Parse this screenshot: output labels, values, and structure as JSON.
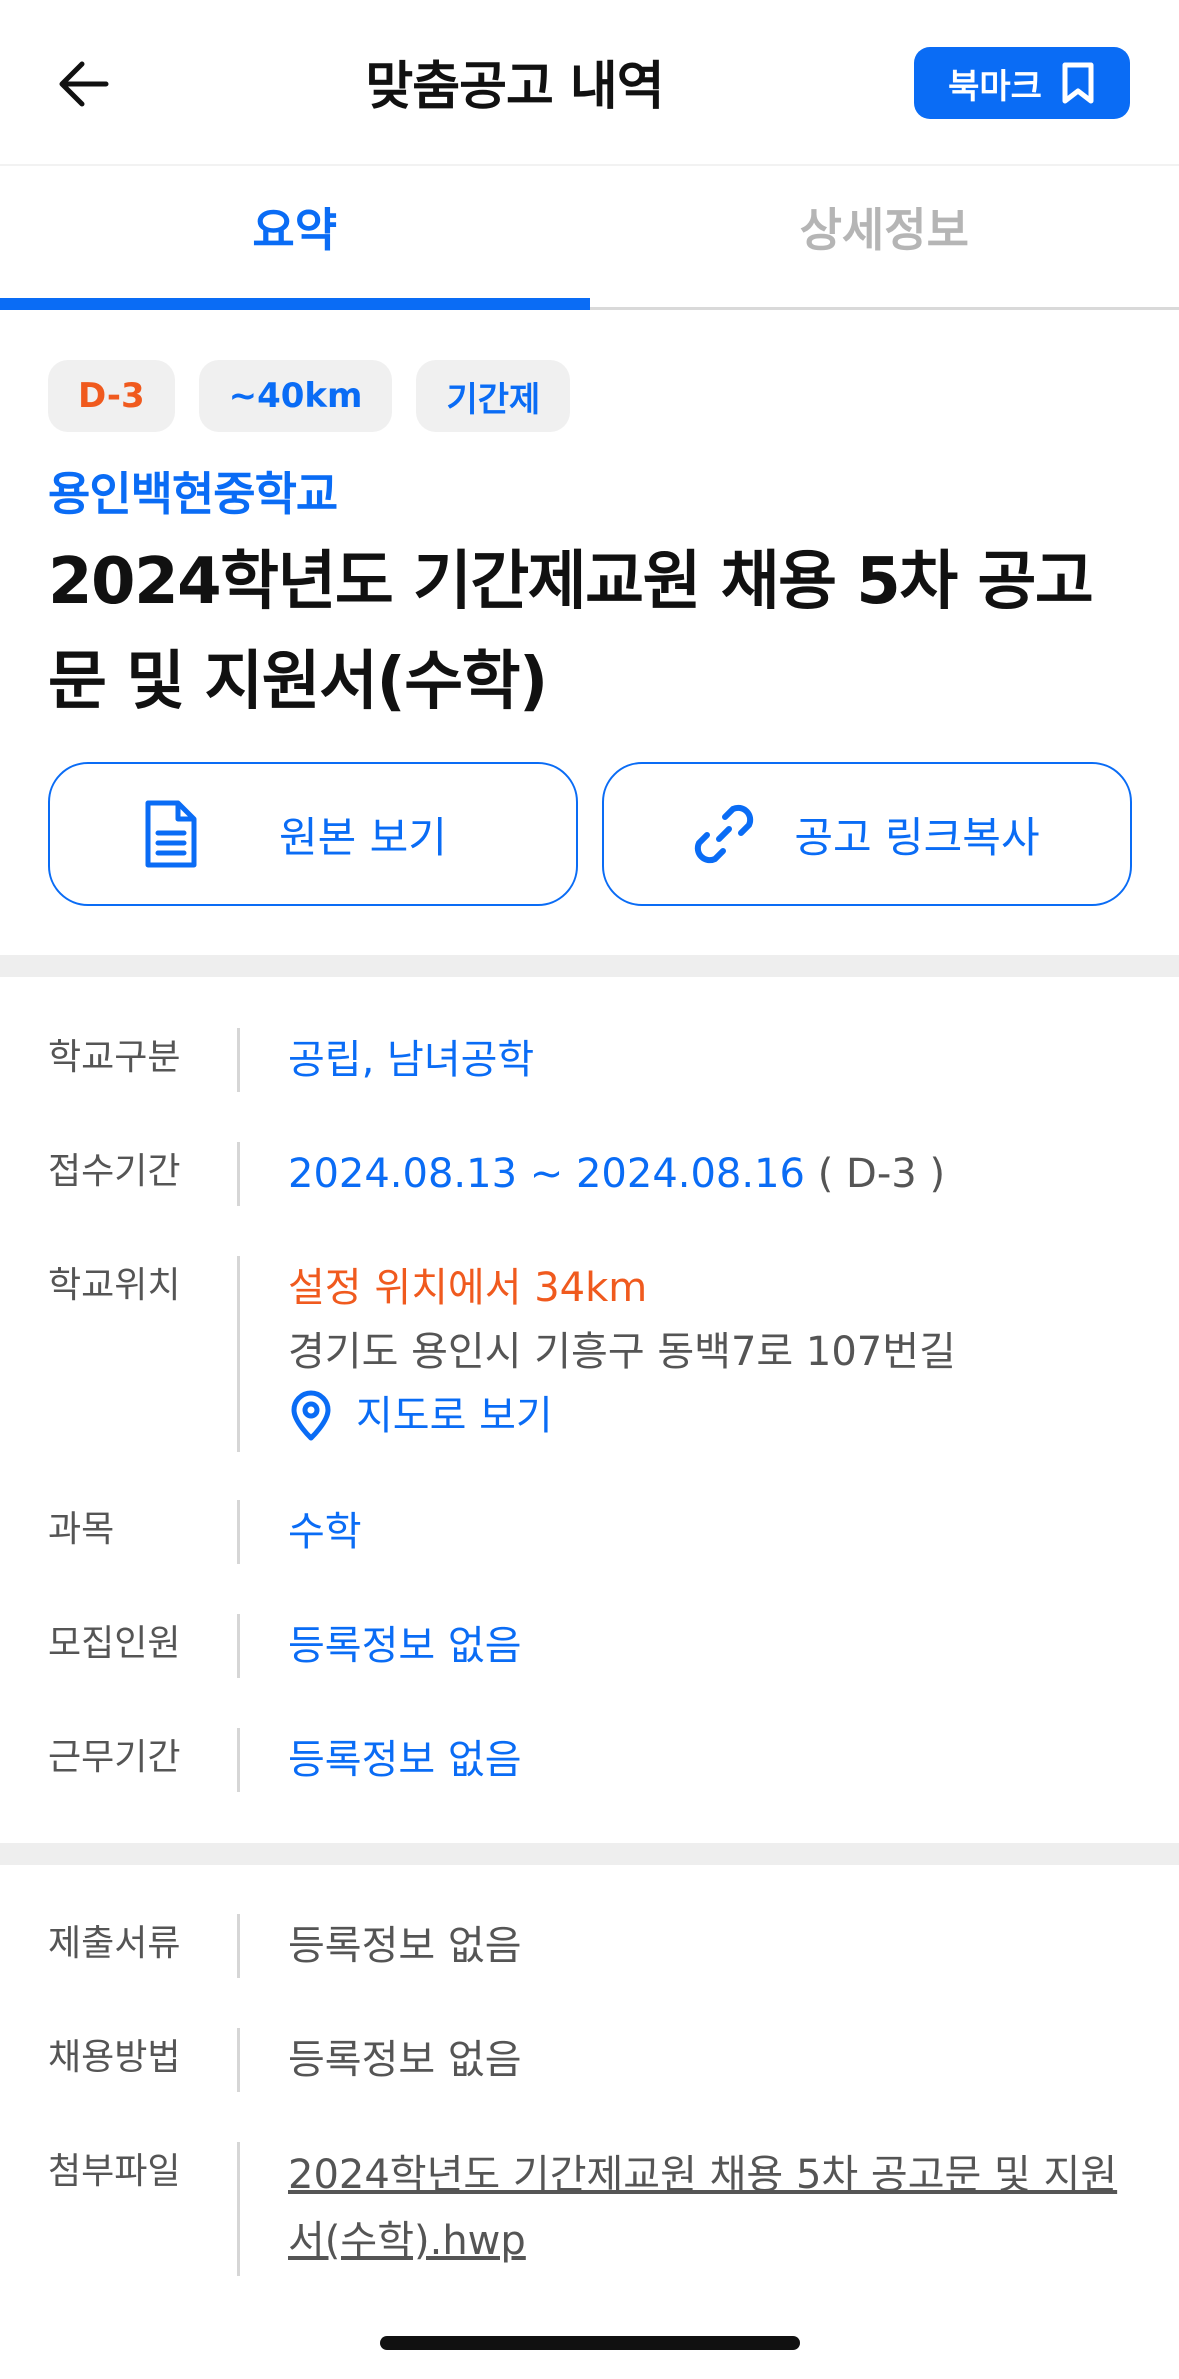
{
  "header": {
    "title": "맞춤공고 내역",
    "bookmark_label": "북마크"
  },
  "tabs": [
    {
      "label": "요약",
      "active": true
    },
    {
      "label": "상세정보",
      "active": false
    }
  ],
  "badges": {
    "deadline": "D-3",
    "distance": "~40km",
    "type": "기간제"
  },
  "school_name": "용인백현중학교",
  "job_title": "2024학년도 기간제교원 채용 5차 공고문 및 지원서(수학)",
  "actions": {
    "original": "원본 보기",
    "copy_link": "공고 링크복사"
  },
  "info": {
    "school_type": {
      "label": "학교구분",
      "value": "공립, 남녀공학"
    },
    "period": {
      "label": "접수기간",
      "value": "2024.08.13 ~ 2024.08.16",
      "suffix": "( D-3 )"
    },
    "location": {
      "label": "학교위치",
      "distance": "설정 위치에서 34km",
      "address": "경기도 용인시 기흥구 동백7로 107번길",
      "map_link": "지도로 보기"
    },
    "subject": {
      "label": "과목",
      "value": "수학"
    },
    "recruit": {
      "label": "모집인원",
      "value": "등록정보 없음"
    },
    "work_period": {
      "label": "근무기간",
      "value": "등록정보 없음"
    }
  },
  "info2": {
    "documents": {
      "label": "제출서류",
      "value": "등록정보 없음"
    },
    "method": {
      "label": "채용방법",
      "value": "등록정보 없음"
    },
    "attachment": {
      "label": "첨부파일",
      "value": "2024학년도 기간제교원 채용 5차 공고문 및 지원서(수학).hwp"
    }
  },
  "colors": {
    "accent": "#0a6cf5",
    "deadline": "#f05a1e"
  }
}
